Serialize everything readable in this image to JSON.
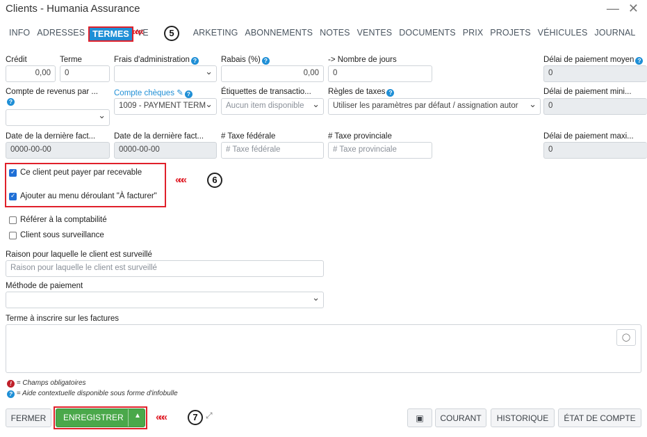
{
  "window": {
    "title": "Clients - Humania Assurance",
    "minimize_glyph": "—",
    "close_glyph": "✕"
  },
  "tabs": [
    {
      "label": "INFO"
    },
    {
      "label": "ADRESSES"
    },
    {
      "label": "TERMES",
      "active": true
    },
    {
      "label": "VE"
    },
    {
      "label": "ARKETING"
    },
    {
      "label": "ABONNEMENTS"
    },
    {
      "label": "NOTES"
    },
    {
      "label": "VENTES"
    },
    {
      "label": "DOCUMENTS"
    },
    {
      "label": "PRIX"
    },
    {
      "label": "PROJETS"
    },
    {
      "label": "VÉHICULES"
    },
    {
      "label": "JOURNAL"
    }
  ],
  "form": {
    "credit": {
      "label": "Crédit",
      "value": "0,00"
    },
    "terme": {
      "label": "Terme",
      "value": "0"
    },
    "frais_admin": {
      "label": "Frais d'administration",
      "value": ""
    },
    "rabais": {
      "label": "Rabais (%)",
      "value": "0,00"
    },
    "nb_jours": {
      "label": "-> Nombre de jours",
      "value": "0"
    },
    "delai_moyen": {
      "label": "Délai de paiement moyen",
      "value": "0"
    },
    "compte_revenus": {
      "label": "Compte de revenus par ...",
      "value": ""
    },
    "compte_cheques": {
      "label": "Compte chèques",
      "value": "1009 - PAYMENT TERM"
    },
    "etiquettes": {
      "label": "Étiquettes de transactio...",
      "value": "Aucun item disponible"
    },
    "regles_taxes": {
      "label": "Règles de taxes",
      "value": "Utiliser les paramètres par défaut / assignation autor"
    },
    "delai_min": {
      "label": "Délai de paiement mini...",
      "value": "0"
    },
    "date_fact1": {
      "label": "Date de la dernière fact...",
      "value": "0000-00-00"
    },
    "date_fact2": {
      "label": "Date de la dernière fact...",
      "value": "0000-00-00"
    },
    "taxe_fed": {
      "label": "# Taxe fédérale",
      "placeholder": "# Taxe fédérale"
    },
    "taxe_prov": {
      "label": "# Taxe provinciale",
      "placeholder": "# Taxe provinciale"
    },
    "delai_max": {
      "label": "Délai de paiement maxi...",
      "value": "0"
    },
    "checkboxes": {
      "recevable": {
        "label": "Ce client peut payer par recevable",
        "checked": true
      },
      "a_facturer": {
        "label": "Ajouter au menu déroulant \"À facturer\"",
        "checked": true
      },
      "comptabilite": {
        "label": "Référer à la comptabilité",
        "checked": false
      },
      "surveillance": {
        "label": "Client sous surveillance",
        "checked": false
      }
    },
    "raison": {
      "label": "Raison pour laquelle le client est surveillé",
      "placeholder": "Raison pour laquelle le client est surveillé"
    },
    "methode": {
      "label": "Méthode de paiement",
      "value": ""
    },
    "terme_factures": {
      "label": "Terme à inscrire sur les factures",
      "value": ""
    }
  },
  "notes": {
    "required": "= Champs obligatoires",
    "help": "= Aide contextuelle disponible sous forme d'infobulle"
  },
  "footer": {
    "fermer": "FERMER",
    "enregistrer": "ENREGISTRER",
    "courant": "COURANT",
    "historique": "HISTORIQUE",
    "etat_compte": "ÉTAT DE COMPTE"
  },
  "annotations": {
    "step5": "5",
    "step6": "6",
    "step7": "7",
    "arrows": "«««"
  },
  "colors": {
    "accent": "#1f8fd6",
    "annotation_red": "#e0202a",
    "save_green": "#4aa84a"
  }
}
